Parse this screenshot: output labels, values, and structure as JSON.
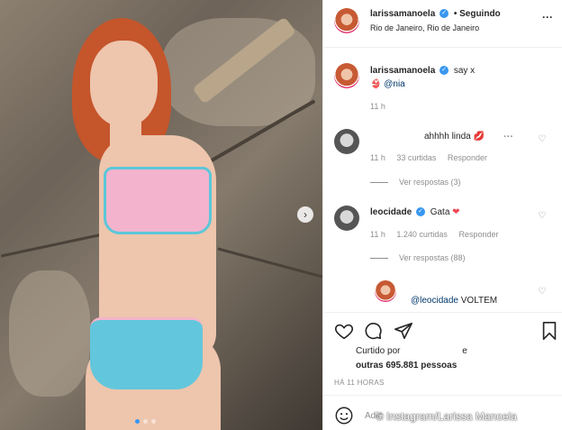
{
  "header": {
    "username": "larissamanoela",
    "status": "• Seguindo",
    "location": "Rio de Janeiro, Rio de Janeiro",
    "more": "···"
  },
  "caption": {
    "username": "larissamanoela",
    "text": "say x",
    "mention": "@nia",
    "emoji": "👙",
    "time": "11 h"
  },
  "comments": [
    {
      "username": "",
      "text": "ahhhh linda",
      "emoji": "💋",
      "time": "11 h",
      "likes": "33 curtidas",
      "reply": "Responder",
      "more": "···",
      "view_replies": "Ver respostas (3)"
    },
    {
      "username": "leocidade",
      "text": "Gata",
      "emoji": "❤",
      "time": "11 h",
      "likes": "1.240 curtidas",
      "reply": "Responder",
      "view_replies": "Ver respostas (88)"
    }
  ],
  "reply": {
    "mention": "@leocidade",
    "text": "VOLTEM"
  },
  "likes": {
    "prefix": "Curtido por",
    "connector": "e",
    "others": "outras 695.881 pessoas"
  },
  "post_time": "HÁ 11 HORAS",
  "add_comment_placeholder": "Adic",
  "watermark": "© Instagram/Larissa Manoela",
  "colors": {
    "verified": "#3897f0",
    "heart_red": "#ed4956",
    "link": "#00376b"
  }
}
